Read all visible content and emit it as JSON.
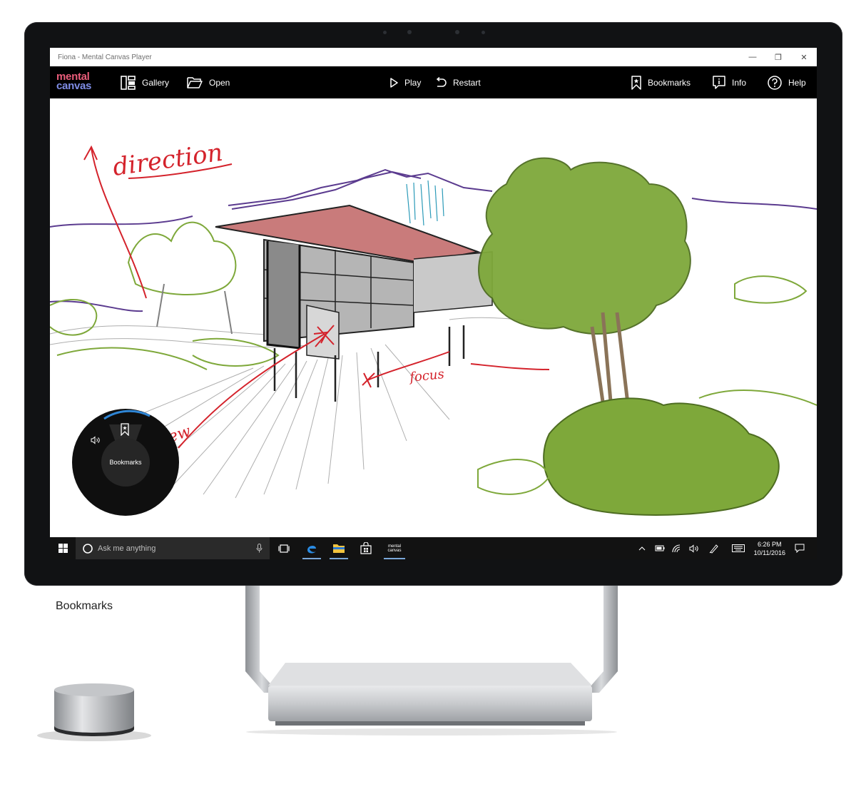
{
  "window": {
    "title": "Fiona - Mental Canvas Player",
    "controls": [
      {
        "name": "minimize-button",
        "glyph": "—"
      },
      {
        "name": "maximize-button",
        "glyph": "❐"
      },
      {
        "name": "close-button",
        "glyph": "✕"
      }
    ]
  },
  "toolbar": {
    "logo": {
      "line1": "mental",
      "line2": "canvas"
    },
    "gallery": "Gallery",
    "open": "Open",
    "play": "Play",
    "restart": "Restart",
    "bookmarks": "Bookmarks",
    "info": "Info",
    "help": "Help"
  },
  "sketch": {
    "annotations": [
      "direction",
      "view",
      "focus"
    ]
  },
  "dial_menu": {
    "center_label": "Bookmarks",
    "items": [
      "volume-icon",
      "bookmark-icon"
    ],
    "accent": "#2f86d6"
  },
  "taskbar": {
    "search_placeholder": "Ask me anything",
    "pinned": [
      "task-view-icon",
      "edge-icon",
      "file-explorer-icon",
      "store-icon",
      "mental-canvas-app-icon"
    ],
    "pinned_app_label": "mental canvas",
    "time": "6:26 PM",
    "date": "10/11/2016"
  },
  "caption": "Bookmarks",
  "colors": {
    "accent_red": "#d4222b",
    "tree_green": "#7ea83a",
    "roof_pink": "#c97b7b",
    "mountain_purple": "#5b3b8f"
  }
}
